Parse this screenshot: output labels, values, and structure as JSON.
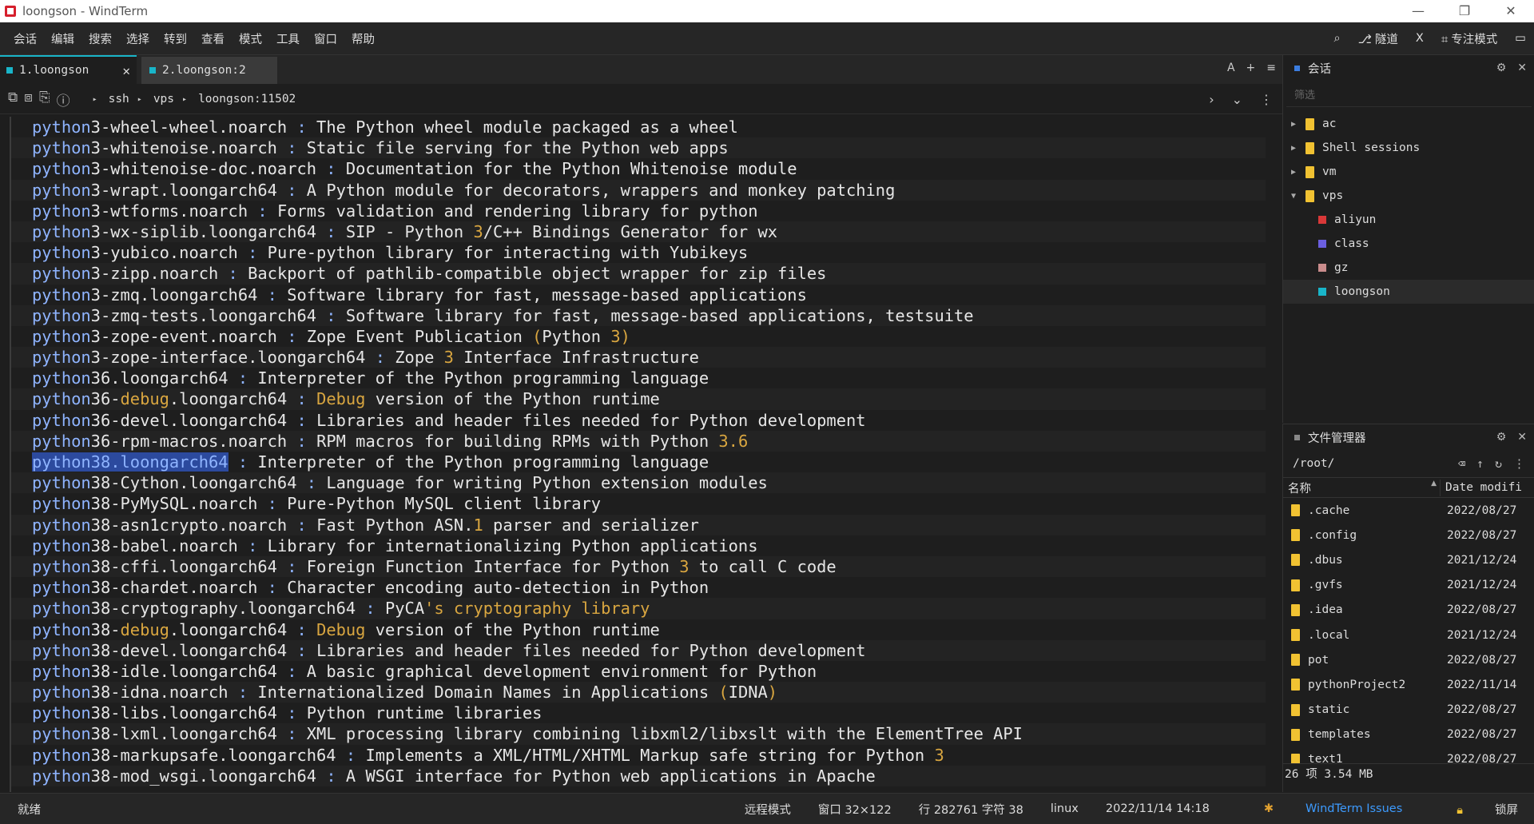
{
  "window": {
    "title": "loongson - WindTerm",
    "minimize": "—",
    "restore": "❐",
    "close": "✕"
  },
  "menu": [
    "会话",
    "编辑",
    "搜索",
    "选择",
    "转到",
    "查看",
    "模式",
    "工具",
    "窗口",
    "帮助"
  ],
  "menu_right": {
    "tunnel": "隧道",
    "x": "X",
    "focus_mode": "专注模式"
  },
  "tabs": [
    {
      "label": "1.loongson",
      "active": true
    },
    {
      "label": "2.loongson:2",
      "active": false
    }
  ],
  "tab_controls": {
    "a": "A",
    "plus": "+",
    "menu": "≡"
  },
  "breadcrumb": [
    "ssh",
    "vps",
    "loongson:11502"
  ],
  "terminal_lines": [
    {
      "pkg": "python",
      "num": "3",
      "rest": "-wheel-wheel.noarch",
      "desc": "The Python wheel module packaged as a wheel"
    },
    {
      "pkg": "python",
      "num": "3",
      "rest": "-whitenoise.noarch",
      "desc": "Static file serving for the Python web apps"
    },
    {
      "pkg": "python",
      "num": "3",
      "rest": "-whitenoise-doc.noarch",
      "desc": "Documentation for the Python Whitenoise module"
    },
    {
      "pkg": "python",
      "num": "3",
      "rest": "-wrapt.loongarch64",
      "desc": "A Python module for decorators, wrappers and monkey patching"
    },
    {
      "pkg": "python",
      "num": "3",
      "rest": "-wtforms.noarch",
      "desc": "Forms validation and rendering library for python"
    },
    {
      "pkg": "python",
      "num": "3",
      "rest": "-wx-siplib.loongarch64",
      "desc": "SIP - Python 3/C++ Bindings Generator for wx"
    },
    {
      "pkg": "python",
      "num": "3",
      "rest": "-yubico.noarch",
      "desc": "Pure-python library for interacting with Yubikeys"
    },
    {
      "pkg": "python",
      "num": "3",
      "rest": "-zipp.noarch",
      "desc": "Backport of pathlib-compatible object wrapper for zip files"
    },
    {
      "pkg": "python",
      "num": "3",
      "rest": "-zmq.loongarch64",
      "desc": "Software library for fast, message-based applications"
    },
    {
      "pkg": "python",
      "num": "3",
      "rest": "-zmq-tests.loongarch64",
      "desc": "Software library for fast, message-based applications, testsuite"
    },
    {
      "pkg": "python",
      "num": "3",
      "rest": "-zope-event.noarch",
      "desc": "Zope Event Publication (Python 3)"
    },
    {
      "pkg": "python",
      "num": "3",
      "rest": "-zope-interface.loongarch64",
      "desc": "Zope 3 Interface Infrastructure"
    },
    {
      "pkg": "python",
      "num": "36",
      "rest": ".loongarch64",
      "desc": "Interpreter of the Python programming language"
    },
    {
      "pkg": "python",
      "num": "36",
      "rest": "-debug.loongarch64",
      "desc": "Debug version of the Python runtime"
    },
    {
      "pkg": "python",
      "num": "36",
      "rest": "-devel.loongarch64",
      "desc": "Libraries and header files needed for Python development"
    },
    {
      "pkg": "python",
      "num": "36",
      "rest": "-rpm-macros.noarch",
      "desc": "RPM macros for building RPMs with Python 3.6"
    },
    {
      "pkg": "python",
      "num": "38",
      "rest": ".loongarch64",
      "desc": "Interpreter of the Python programming language",
      "selected": true
    },
    {
      "pkg": "python",
      "num": "38",
      "rest": "-Cython.loongarch64",
      "desc": "Language for writing Python extension modules"
    },
    {
      "pkg": "python",
      "num": "38",
      "rest": "-PyMySQL.noarch",
      "desc": "Pure-Python MySQL client library"
    },
    {
      "pkg": "python",
      "num": "38",
      "rest": "-asn1crypto.noarch",
      "desc": "Fast Python ASN.1 parser and serializer"
    },
    {
      "pkg": "python",
      "num": "38",
      "rest": "-babel.noarch",
      "desc": "Library for internationalizing Python applications"
    },
    {
      "pkg": "python",
      "num": "38",
      "rest": "-cffi.loongarch64",
      "desc": "Foreign Function Interface for Python 3 to call C code"
    },
    {
      "pkg": "python",
      "num": "38",
      "rest": "-chardet.noarch",
      "desc": "Character encoding auto-detection in Python"
    },
    {
      "pkg": "python",
      "num": "38",
      "rest": "-cryptography.loongarch64",
      "desc": "PyCA's cryptography library"
    },
    {
      "pkg": "python",
      "num": "38",
      "rest": "-debug.loongarch64",
      "desc": "Debug version of the Python runtime"
    },
    {
      "pkg": "python",
      "num": "38",
      "rest": "-devel.loongarch64",
      "desc": "Libraries and header files needed for Python development"
    },
    {
      "pkg": "python",
      "num": "38",
      "rest": "-idle.loongarch64",
      "desc": "A basic graphical development environment for Python"
    },
    {
      "pkg": "python",
      "num": "38",
      "rest": "-idna.noarch",
      "desc": "Internationalized Domain Names in Applications (IDNA)"
    },
    {
      "pkg": "python",
      "num": "38",
      "rest": "-libs.loongarch64",
      "desc": "Python runtime libraries"
    },
    {
      "pkg": "python",
      "num": "38",
      "rest": "-lxml.loongarch64",
      "desc": "XML processing library combining libxml2/libxslt with the ElementTree API"
    },
    {
      "pkg": "python",
      "num": "38",
      "rest": "-markupsafe.loongarch64",
      "desc": "Implements a XML/HTML/XHTML Markup safe string for Python 3"
    },
    {
      "pkg": "python",
      "num": "38",
      "rest": "-mod_wsgi.loongarch64",
      "desc": "A WSGI interface for Python web applications in Apache"
    }
  ],
  "sessions_panel": {
    "title": "会话",
    "filter_placeholder": "筛选",
    "items": [
      {
        "label": "ac",
        "type": "folder",
        "expanded": false,
        "level": 0
      },
      {
        "label": "Shell sessions",
        "type": "folder",
        "expanded": false,
        "level": 0
      },
      {
        "label": "vm",
        "type": "folder",
        "expanded": false,
        "level": 0
      },
      {
        "label": "vps",
        "type": "folder",
        "expanded": true,
        "level": 0
      },
      {
        "label": "aliyun",
        "type": "session",
        "color": "#d93838",
        "level": 1
      },
      {
        "label": "class",
        "type": "session",
        "color": "#6b5fe0",
        "level": 1
      },
      {
        "label": "gz",
        "type": "session",
        "color": "#c98c8c",
        "level": 1
      },
      {
        "label": "loongson",
        "type": "session",
        "color": "#19b5c9",
        "level": 1,
        "selected": true
      }
    ]
  },
  "file_manager": {
    "title": "文件管理器",
    "path": "/root/",
    "col_name": "名称",
    "col_date": "Date modifi",
    "files": [
      {
        "name": ".cache",
        "date": "2022/08/27"
      },
      {
        "name": ".config",
        "date": "2022/08/27"
      },
      {
        "name": ".dbus",
        "date": "2021/12/24"
      },
      {
        "name": ".gvfs",
        "date": "2021/12/24"
      },
      {
        "name": ".idea",
        "date": "2022/08/27"
      },
      {
        "name": ".local",
        "date": "2021/12/24"
      },
      {
        "name": "pot",
        "date": "2022/08/27"
      },
      {
        "name": "pythonProject2",
        "date": "2022/11/14"
      },
      {
        "name": "static",
        "date": "2022/08/27"
      },
      {
        "name": "templates",
        "date": "2022/08/27"
      },
      {
        "name": "text1",
        "date": "2022/08/27"
      }
    ],
    "footer": "26 项 3.54 MB"
  },
  "status": {
    "left": "就绪",
    "remote_mode": "远程模式",
    "window_size": "窗口 32×122",
    "position": "行 282761 字符 38",
    "os": "linux",
    "datetime": "2022/11/14 14:18",
    "issues_link": "WindTerm Issues",
    "lock": "锁屏"
  },
  "colors": {
    "accent": "#19b5c9",
    "package_blue": "#8fb4ff",
    "number_yellow": "#d9a640",
    "selection": "#2c4a9e"
  }
}
